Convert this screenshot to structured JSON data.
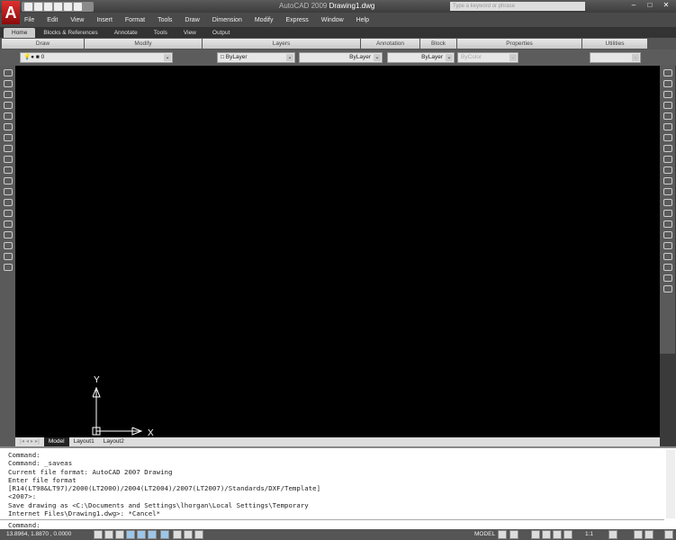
{
  "app": {
    "name": "AutoCAD 2009",
    "document": "Drawing1.dwg",
    "search_placeholder": "Type a keyword or phrase",
    "logo_letter": "A"
  },
  "menu": [
    "File",
    "Edit",
    "View",
    "Insert",
    "Format",
    "Tools",
    "Draw",
    "Dimension",
    "Modify",
    "Express",
    "Window",
    "Help"
  ],
  "ribbon_tabs": [
    "Home",
    "Blocks & References",
    "Annotate",
    "Tools",
    "View",
    "Output"
  ],
  "panels": [
    "Draw",
    "Modify",
    "Layers",
    "Annotation",
    "Block",
    "Properties",
    "Utilities"
  ],
  "properties": {
    "layer": "0",
    "color": "ByLayer",
    "linetype": "ByLayer",
    "lineweight": "ByLayer",
    "plotstyle": "ByColor"
  },
  "axes": {
    "x": "X",
    "y": "Y"
  },
  "layout_tabs": [
    "Model",
    "Layout1",
    "Layout2"
  ],
  "command_history": [
    "Command:",
    "Command: _saveas",
    "Current file format: AutoCAD 2007 Drawing",
    "Enter file format",
    "[R14(LT98&LT97)/2000(LT2000)/2004(LT2004)/2007(LT2007)/Standards/DXF/Template]",
    "<2007>:",
    "Save drawing as <C:\\Documents and Settings\\lhorgan\\Local Settings\\Temporary",
    "Internet Files\\Drawing1.dwg>: *Cancel*"
  ],
  "command_prompt": "Command:",
  "status": {
    "coords": "13.8964, 1.8870 , 0.0000",
    "space": "MODEL",
    "scale": "1:1"
  }
}
